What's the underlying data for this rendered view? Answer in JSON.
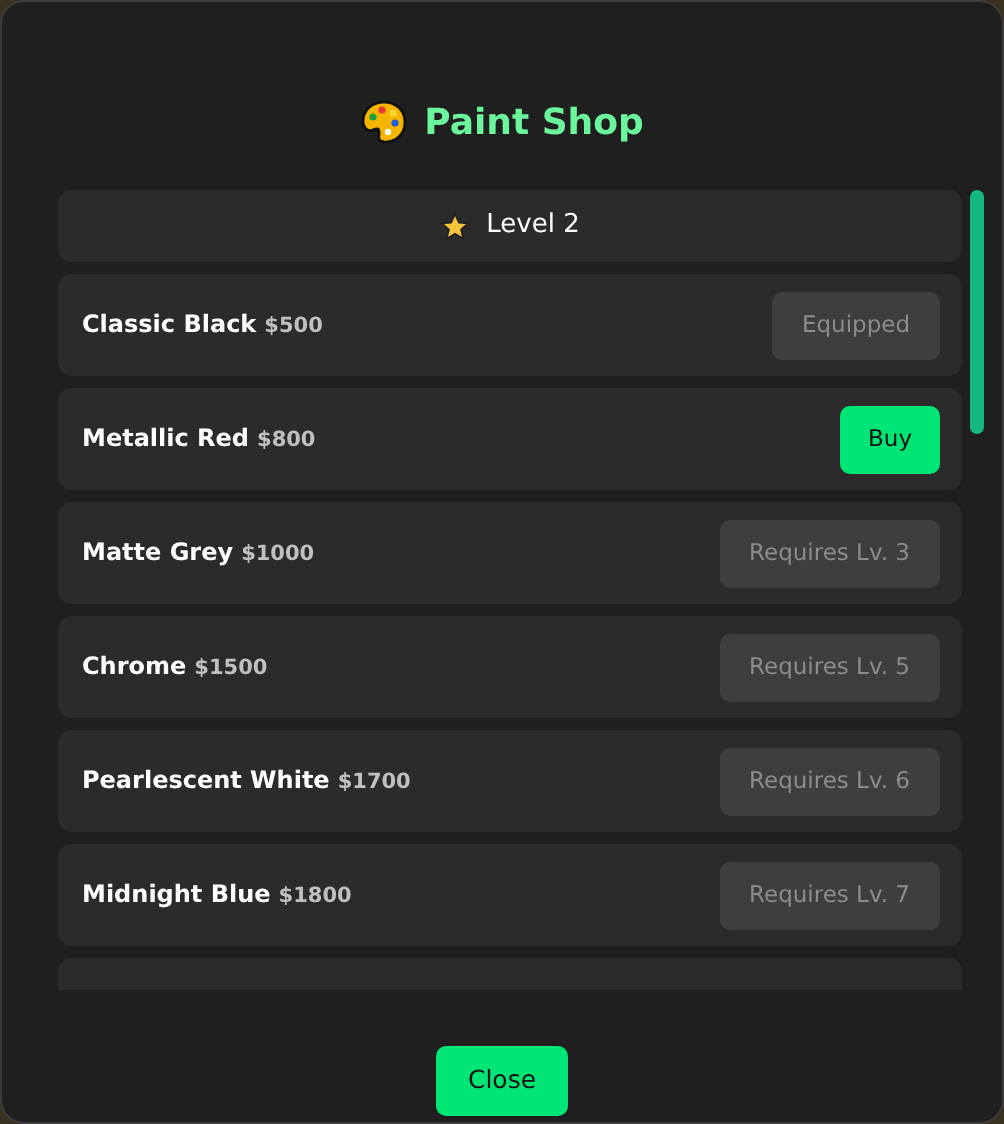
{
  "title": "Paint Shop",
  "level": "Level 2",
  "paints": [
    {
      "name": "Classic Black",
      "price": "$500",
      "action": "Equipped",
      "kind": "equipped"
    },
    {
      "name": "Metallic Red",
      "price": "$800",
      "action": "Buy",
      "kind": "buy"
    },
    {
      "name": "Matte Grey",
      "price": "$1000",
      "action": "Requires Lv. 3",
      "kind": "locked"
    },
    {
      "name": "Chrome",
      "price": "$1500",
      "action": "Requires Lv. 5",
      "kind": "locked"
    },
    {
      "name": "Pearlescent White",
      "price": "$1700",
      "action": "Requires Lv. 6",
      "kind": "locked"
    },
    {
      "name": "Midnight Blue",
      "price": "$1800",
      "action": "Requires Lv. 7",
      "kind": "locked"
    }
  ],
  "close": "Close"
}
